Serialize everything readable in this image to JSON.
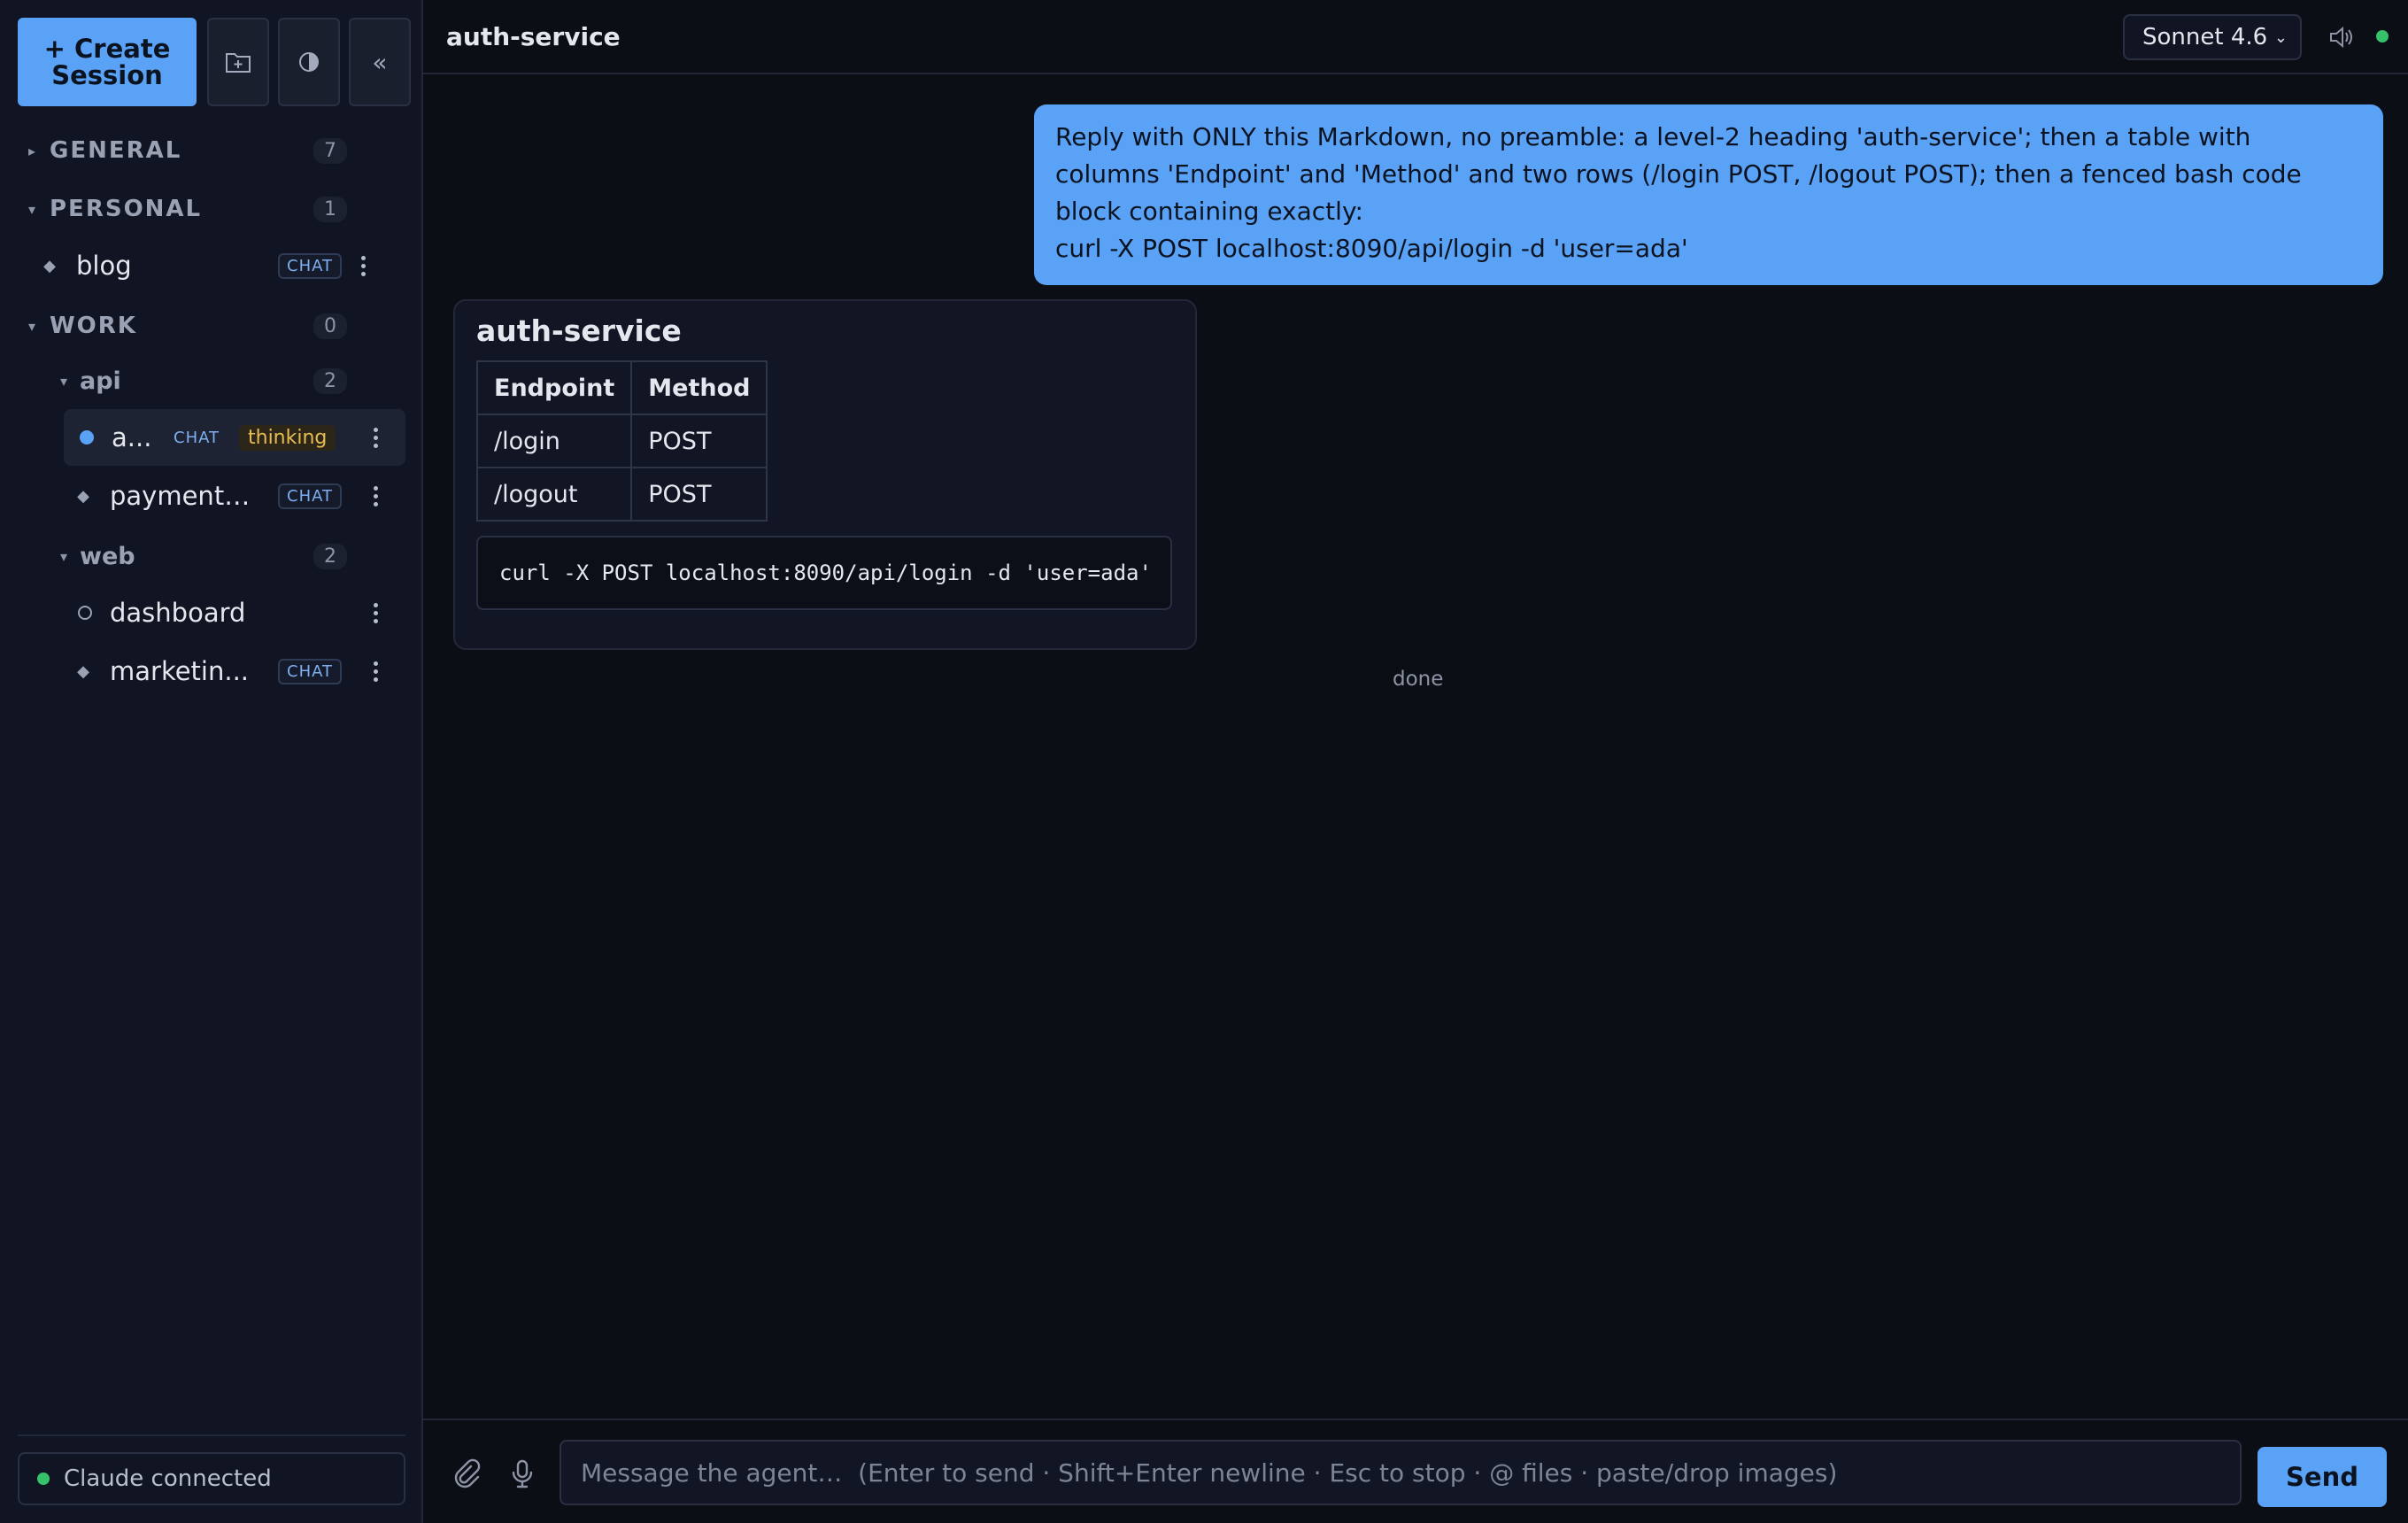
{
  "sidebar": {
    "create_label": "+ Create\nSession",
    "groups": {
      "general": {
        "label": "GENERAL",
        "count": "7"
      },
      "personal": {
        "label": "PERSONAL",
        "count": "1"
      },
      "work": {
        "label": "WORK",
        "count": "0"
      }
    },
    "subgroups": {
      "api": {
        "label": "api",
        "count": "2"
      },
      "web": {
        "label": "web",
        "count": "2"
      }
    },
    "items": {
      "blog": {
        "label": "blog",
        "badge": "CHAT"
      },
      "auth": {
        "label": "a...",
        "badge": "CHAT",
        "status": "thinking"
      },
      "payments": {
        "label": "payments...",
        "badge": "CHAT"
      },
      "dashboard": {
        "label": "dashboard"
      },
      "marketing": {
        "label": "marketin...",
        "badge": "CHAT"
      }
    },
    "status": "Claude connected"
  },
  "header": {
    "title": "auth-service",
    "model": "Sonnet 4.6"
  },
  "messages": {
    "user": "Reply with ONLY this Markdown, no preamble: a level-2 heading 'auth-service'; then a table with columns 'Endpoint' and 'Method' and two rows (/login POST, /logout POST); then a fenced bash code block containing exactly:\ncurl -X POST localhost:8090/api/login -d 'user=ada'",
    "assistant": {
      "heading": "auth-service",
      "table": {
        "headers": [
          "Endpoint",
          "Method"
        ],
        "rows": [
          [
            "/login",
            "POST"
          ],
          [
            "/logout",
            "POST"
          ]
        ]
      },
      "code": "curl -X POST localhost:8090/api/login -d 'user=ada'"
    },
    "status": "done"
  },
  "composer": {
    "placeholder": "Message the agent…  (Enter to send · Shift+Enter newline · Esc to stop · @ files · paste/drop images)",
    "send_label": "Send"
  },
  "colors": {
    "accent": "#5aa2f6",
    "thinking": "#e9bc52",
    "connected": "#36c26b",
    "background": "#0b0e15"
  }
}
